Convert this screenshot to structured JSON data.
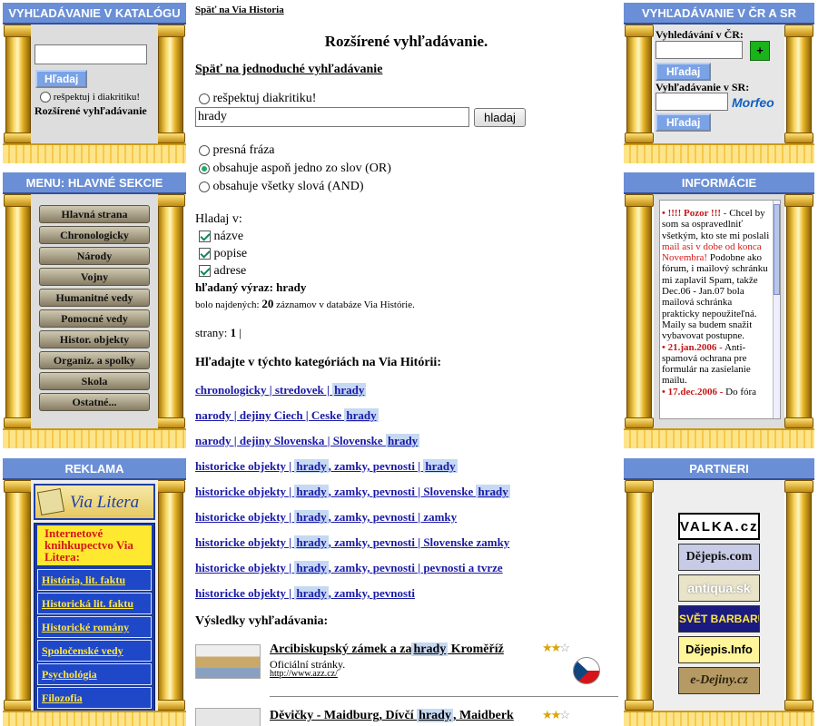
{
  "left_top": {
    "title": "VYHĽADÁVANIE V KATALÓGU",
    "search_button": "Hľadaj",
    "diacritics_label": "rešpektuj i diakritiku!",
    "advanced_link": "Rozšírené vyhľadávanie"
  },
  "left_menu": {
    "title": "MENU: HLAVNÉ SEKCIE",
    "items": [
      "Hlavná strana",
      "Chronologicky",
      "Národy",
      "Vojny",
      "Humanitné vedy",
      "Pomocné vedy",
      "Histor. objekty",
      "Organiz. a spolky",
      "Skola",
      "Ostatné..."
    ]
  },
  "left_ads": {
    "title": "REKLAMA",
    "logo_text": "Via Litera",
    "shop_title": "Internetové knihkupectvo Via Litera:",
    "items": [
      "História, lit. faktu",
      "Historická lit. faktu",
      "Historické romány",
      "Spoločenské vedy",
      "Psychológia",
      "Filozofia"
    ]
  },
  "main": {
    "back_link": "Späť na Via Historia",
    "heading": "Rozšírené vyhľadávanie.",
    "simple_link": "Späť na jednoduché vyhľadávanie",
    "diacritics_label": "rešpektuj diakritiku!",
    "query_value": "hrady",
    "search_button": "hladaj",
    "mode_options": [
      "presná fráza",
      "obsahuje aspoň jedno zo slov (OR)",
      "obsahuje všetky slová (AND)"
    ],
    "search_in_label": "Hladaj v:",
    "field_options": [
      "názve",
      "popise",
      "adrese"
    ],
    "expr_label": "hľadaný výraz:",
    "expr_value": "hrady",
    "found_prefix": "bolo najdených:",
    "found_count": "20",
    "found_suffix": "záznamov v databáze Via Histórie.",
    "pages_label": "strany:",
    "pages_current": "1",
    "pages_sep": "|",
    "categories_heading": "Hľadajte v týchto kategóriách na Via Hitórii:",
    "categories": [
      {
        "pre": "chronologicky | stredovek | ",
        "hl": "hrady",
        "post": " "
      },
      {
        "pre": "narody | dejiny Ciech | Ceske ",
        "hl": "hrady",
        "post": " "
      },
      {
        "pre": "narody | dejiny Slovenska | Slovenske ",
        "hl": "hrady",
        "post": " "
      },
      {
        "pre": "historicke objekty | ",
        "hl": "hrady",
        "post": ", zamky, pevnosti | ",
        "hl2": "hrady",
        "post2": " "
      },
      {
        "pre": "historicke objekty | ",
        "hl": "hrady",
        "post": ", zamky, pevnosti | Slovenske ",
        "hl2": "hrady",
        "post2": " "
      },
      {
        "pre": "historicke objekty | ",
        "hl": "hrady",
        "post": ", zamky, pevnosti | zamky "
      },
      {
        "pre": "historicke objekty | ",
        "hl": "hrady",
        "post": ", zamky, pevnosti | Slovenske zamky "
      },
      {
        "pre": "historicke objekty | ",
        "hl": "hrady",
        "post": ", zamky, pevnosti | pevnosti a tvrze "
      },
      {
        "pre": "historicke objekty | ",
        "hl": "hrady",
        "post": ", zamky, pevnosti "
      }
    ],
    "results_heading": "Výsledky vyhľadávania:",
    "results": [
      {
        "title_pre": "Arcibiskupský zámek a za",
        "title_hl": "hrady",
        "title_post": " Kroměříž",
        "desc": "Oficiální stránky.",
        "url": "http://www.azz.cz/",
        "stars": 2
      },
      {
        "title_pre": "Děvičky - Maidburg, Dívčí ",
        "title_hl": "hrady",
        "title_post": ", Maidberk",
        "desc": "",
        "url": "",
        "stars": 2
      }
    ]
  },
  "right_top": {
    "title": "VYHĽADÁVANIE V ČR A SR",
    "cz_label": "Vyhledávání v ČR:",
    "sk_label": "Vyhľadávanie v SR:",
    "button": "Hľadaj",
    "morfeo": "Morfeo"
  },
  "right_info": {
    "title": "INFORMÁCIE",
    "entries": [
      {
        "date": "• !!!! Pozor !!! -",
        "text_a": "Chcel by som sa ospravedlniť všetkým, kto ste mi poslali",
        "text_red": "mail asi v dobe od konca Novembra!",
        "text_b": "Podobne ako fórum, i mailový schránku mi zaplavil Spam, takže Dec.06 - Jan.07 bola mailová schránka prakticky nepoužiteľná. Maily sa budem snažit vybavovat postupne."
      },
      {
        "date": "• 21.jan.2006 -",
        "text_a": "Anti-spamová ochrana pre formulár na zasielanie mailu.",
        "text_red": "",
        "text_b": ""
      },
      {
        "date": "• 17.dec.2006 -",
        "text_a": "Do fóra",
        "text_red": "",
        "text_b": ""
      }
    ]
  },
  "right_partners": {
    "title": "PARTNERI",
    "items": [
      "VALKA.cz",
      "Dějepis.com",
      "antiqua.sk",
      "SVĚT BARBARŮ",
      "Dějepis.Info",
      "e-Dejiny.cz"
    ]
  }
}
